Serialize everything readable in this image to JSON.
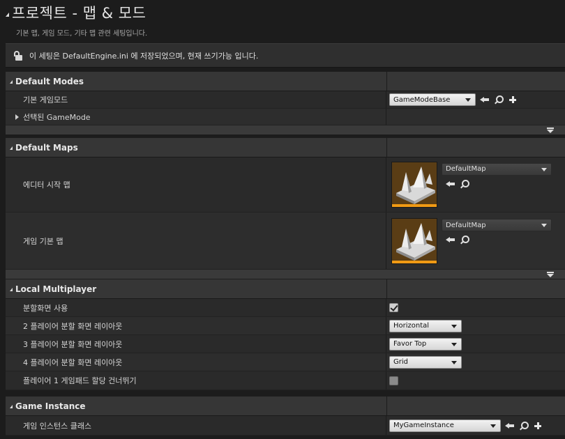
{
  "header": {
    "title": "프로젝트 - 맵 & 모드",
    "subtitle": "기본 맵, 게임 모드, 기타 맵 관련 세팅입니다."
  },
  "infobar": {
    "text": "이 세팅은 DefaultEngine.ini 에 저장되었으며, 현재 쓰기가능 입니다.",
    "icon": "unlock-icon"
  },
  "default_modes": {
    "title": "Default Modes",
    "rows": [
      {
        "label": "기본 게임모드",
        "value": "GameModeBase"
      },
      {
        "label": "선택된 GameMode"
      }
    ]
  },
  "default_maps": {
    "title": "Default Maps",
    "rows": [
      {
        "label": "에디터 시작 맵",
        "value": "DefaultMap"
      },
      {
        "label": "게임 기본 맵",
        "value": "DefaultMap"
      }
    ]
  },
  "local_multiplayer": {
    "title": "Local Multiplayer",
    "rows": [
      {
        "label": "분할화면 사용",
        "checked": true
      },
      {
        "label": "2 플레이어 분할 화면 레이아웃",
        "value": "Horizontal"
      },
      {
        "label": "3 플레이어 분할 화면 레이아웃",
        "value": "Favor Top"
      },
      {
        "label": "4 플레이어 분할 화면 레이아웃",
        "value": "Grid"
      },
      {
        "label": "플레이어 1 게임패드 할당 건너뛰기",
        "checked": false
      }
    ]
  },
  "game_instance": {
    "title": "Game Instance",
    "rows": [
      {
        "label": "게임 인스턴스 클래스",
        "value": "MyGameInstance"
      }
    ]
  },
  "colors": {
    "background": "#1c1c1c",
    "section_header": "#363636",
    "row": "#2a2a2a",
    "thumbnail_accent": "#f09a14"
  }
}
